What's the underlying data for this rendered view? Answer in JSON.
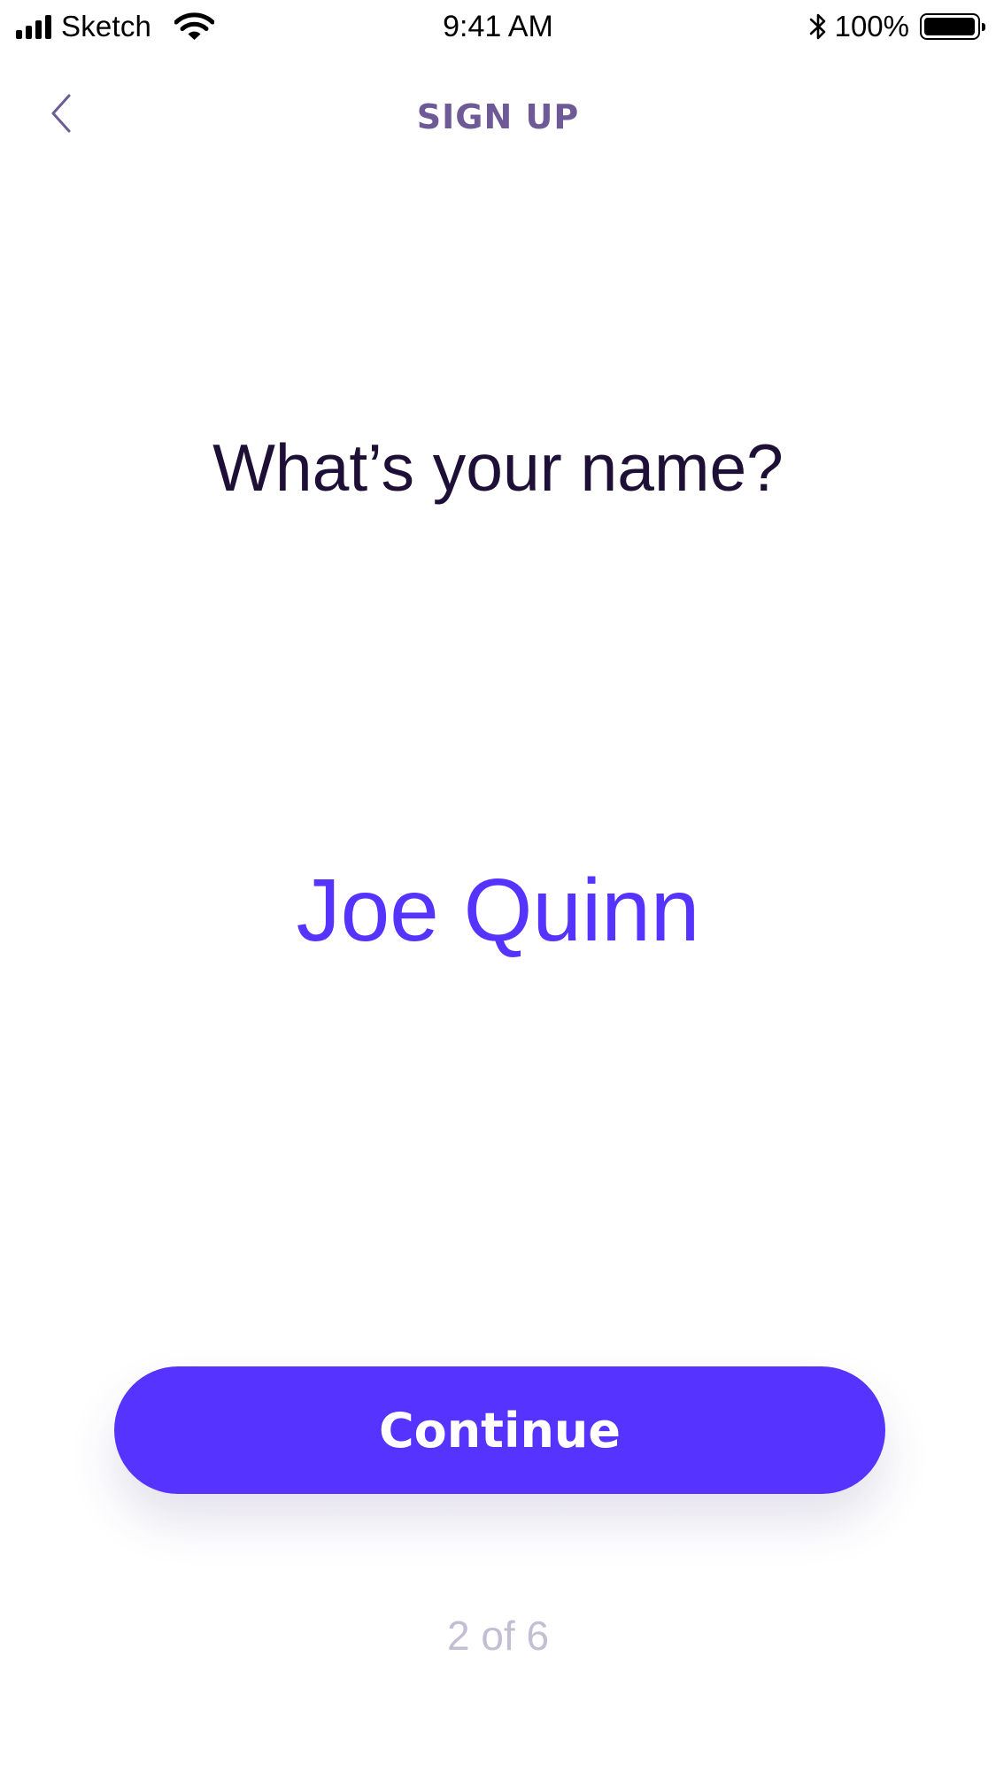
{
  "status_bar": {
    "carrier": "Sketch",
    "time": "9:41 AM",
    "battery_percent": "100%",
    "battery_level": 1.0,
    "signal_bars": 4,
    "icons": [
      "signal-icon",
      "wifi-icon",
      "bluetooth-icon",
      "battery-icon"
    ]
  },
  "nav": {
    "title": "SIGN UP",
    "back_icon": "chevron-left-icon"
  },
  "content": {
    "question": "What’s your name?",
    "name_value": "Joe Quinn",
    "name_placeholder": ""
  },
  "continue_button": {
    "label": "Continue"
  },
  "progress": {
    "label": "2 of 6",
    "current_step": 2,
    "total_steps": 6
  },
  "colors": {
    "accent": "#5733FF",
    "title_purple": "#6E5A96",
    "heading_dark": "#1E0F37",
    "muted": "#C4BED4",
    "button_text": "#FFFFFF"
  }
}
